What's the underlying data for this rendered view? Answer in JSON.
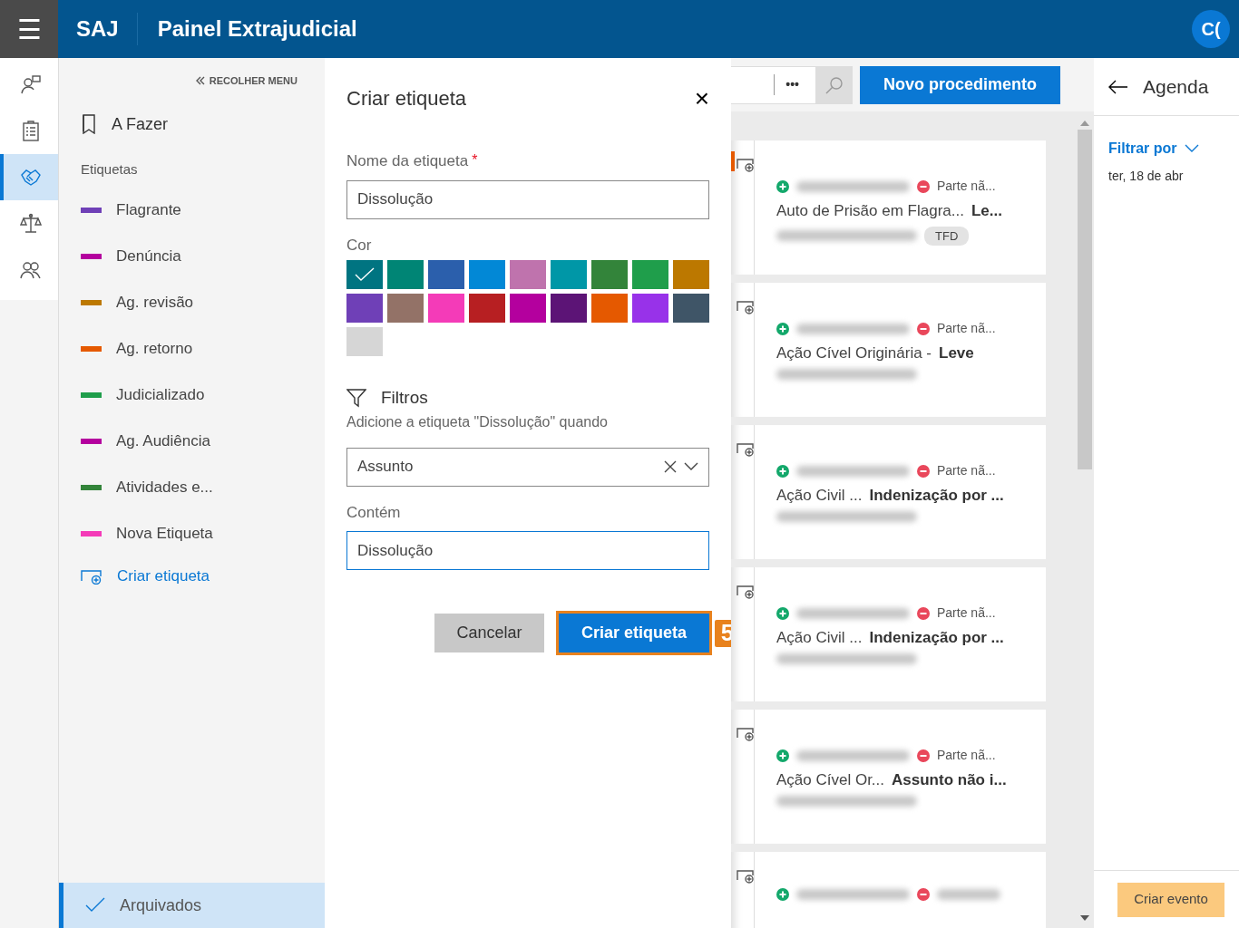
{
  "header": {
    "menu": "☰",
    "brand": "SAJ",
    "title": "Painel Extrajudicial",
    "avatar": "C("
  },
  "rail": [
    {
      "selected": false
    },
    {
      "selected": false
    },
    {
      "selected": true
    },
    {
      "selected": false
    },
    {
      "selected": false
    }
  ],
  "side_menu": {
    "collapse": "RECOLHER MENU",
    "todo": "A Fazer",
    "section": "Etiquetas",
    "labels": [
      {
        "label": "Flagrante",
        "color": "#6f40b7"
      },
      {
        "label": "Denúncia",
        "color": "#b4009e"
      },
      {
        "label": "Ag. revisão",
        "color": "#bc7800"
      },
      {
        "label": "Ag. retorno",
        "color": "#e55900"
      },
      {
        "label": "Judicializado",
        "color": "#1f9e4b"
      },
      {
        "label": "Ag. Audiência",
        "color": "#b4009e"
      },
      {
        "label": "Atividades e...",
        "color": "#33843a"
      },
      {
        "label": "Nova Etiqueta",
        "color": "#f43bb8"
      }
    ],
    "create": "Criar etiqueta",
    "archived": {
      "label": "Arquivados",
      "selected": true
    }
  },
  "dialog": {
    "title": "Criar etiqueta",
    "close": "×",
    "name_label": "Nome da etiqueta",
    "required_mark": "*",
    "name_value": "Dissolução",
    "color_label": "Cor",
    "swatches": [
      {
        "color": "#007481",
        "selected": true
      },
      {
        "color": "#008575",
        "selected": false
      },
      {
        "color": "#2b5fac",
        "selected": false
      },
      {
        "color": "#0288d6",
        "selected": false
      },
      {
        "color": "#bf73ad",
        "selected": false
      },
      {
        "color": "#0097a7",
        "selected": false
      },
      {
        "color": "#33843a",
        "selected": false
      },
      {
        "color": "#1f9e4b",
        "selected": false
      },
      {
        "color": "#bc7800",
        "selected": false
      },
      {
        "color": "#6f40b7",
        "selected": false
      },
      {
        "color": "#937267",
        "selected": false
      },
      {
        "color": "#f43bb8",
        "selected": false
      },
      {
        "color": "#b71f22",
        "selected": false
      },
      {
        "color": "#b4009e",
        "selected": false
      },
      {
        "color": "#5c1476",
        "selected": false
      },
      {
        "color": "#e55900",
        "selected": false
      },
      {
        "color": "#9832e9",
        "selected": false
      },
      {
        "color": "#3f5567",
        "selected": false
      },
      {
        "color": "#d6d6d6",
        "selected": false
      }
    ],
    "filters_title": "Filtros",
    "filters_hint": "Adicione a etiqueta \"Dissolução\" quando",
    "field_value": "Assunto",
    "contains_label": "Contém",
    "contains_value": "Dissolução",
    "buttons": [
      {
        "label": "Cancelar",
        "kind": "secondary",
        "highlighted": false
      },
      {
        "label": "Criar etiqueta",
        "kind": "primary",
        "highlighted": true
      }
    ],
    "step_badge": "5"
  },
  "toolbar": {
    "more": "•••",
    "new_button": "Novo procedimento"
  },
  "cards": [
    {
      "flagged": true,
      "status": "Parte nã...",
      "class": "Auto de Prisão em Flagra...",
      "subject": "Le...",
      "tag": "TFD"
    },
    {
      "flagged": false,
      "status": "Parte nã...",
      "class": "Ação Cível Originária -",
      "subject": "Leve"
    },
    {
      "flagged": false,
      "status": "Parte nã...",
      "class": "Ação Civil ...",
      "subject": "Indenização por ..."
    },
    {
      "flagged": false,
      "status": "Parte nã...",
      "class": "Ação Civil ...",
      "subject": "Indenização por ..."
    },
    {
      "flagged": false,
      "status": "Parte nã...",
      "class": "Ação Cível Or...",
      "subject": "Assunto não i..."
    },
    {
      "flagged": false
    }
  ],
  "agenda": {
    "title": "Agenda",
    "filter": "Filtrar por",
    "date": "ter, 18 de abr",
    "create_event": "Criar evento"
  }
}
